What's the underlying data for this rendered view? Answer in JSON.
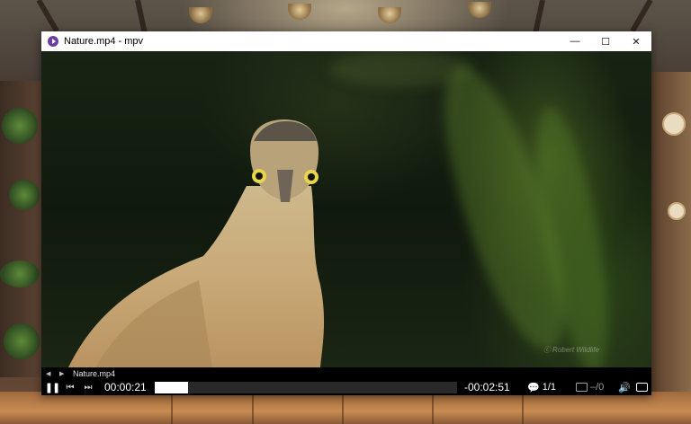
{
  "window": {
    "title": "Nature.mp4 - mpv",
    "controls": {
      "minimize": "—",
      "maximize": "☐",
      "close": "✕"
    }
  },
  "player": {
    "filename": "Nature.mp4",
    "time_elapsed": "00:00:21",
    "time_remaining": "-00:02:51",
    "progress_fraction": 0.11,
    "chapters": "1/1",
    "subtitles": "–/0",
    "icons": {
      "prev_file": "triangle-left-icon",
      "next_file": "triangle-right-icon",
      "play_pause": "pause-icon",
      "skip_back": "skip-back-icon",
      "skip_forward": "skip-forward-icon",
      "chapters": "speech-bubble-icon",
      "subtitles": "subtitles-icon",
      "volume": "speaker-icon",
      "fullscreen": "fullscreen-icon"
    }
  },
  "colors": {
    "app_icon": "#6b3fa0",
    "osc_background": "#000000",
    "seek_fill": "#ffffff"
  }
}
